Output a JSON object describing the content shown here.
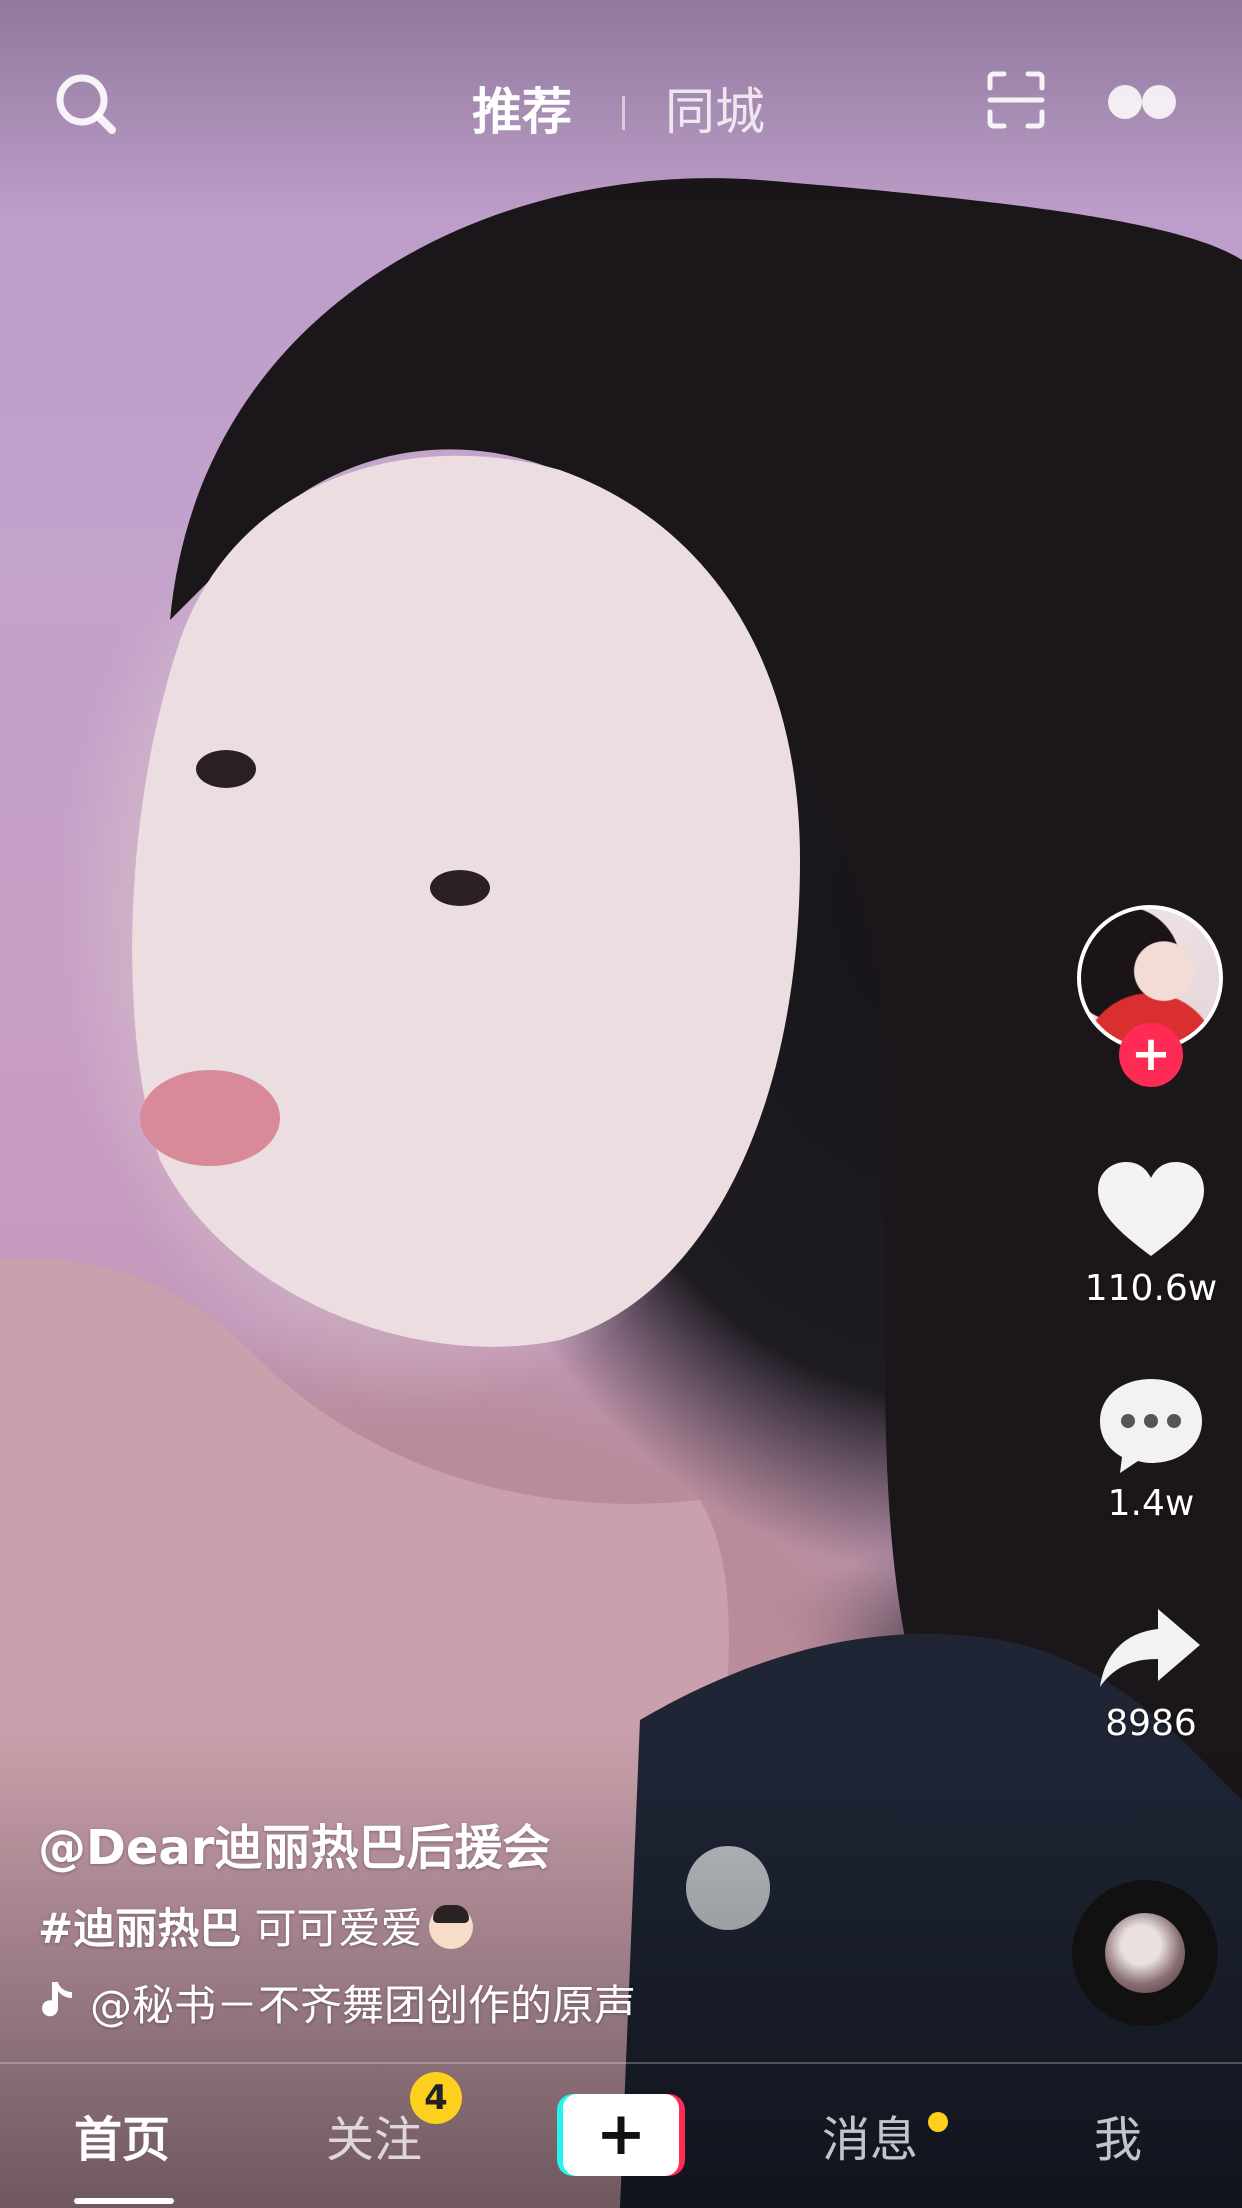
{
  "top_bar": {
    "search_icon": "search-icon",
    "tabs": [
      {
        "label": "推荐",
        "active": true
      },
      {
        "label": "同城",
        "active": false
      }
    ],
    "scan_icon": "scan-icon",
    "live_icon": "live-dots-icon"
  },
  "right_rail": {
    "avatar": "creator-avatar",
    "follow_icon": "+",
    "like_count": "110.6w",
    "comment_count": "1.4w",
    "share_count": "8986",
    "music_disc": "music-disc-icon"
  },
  "caption": {
    "username": "@Dear迪丽热巴后援会",
    "hashtag": "#迪丽热巴",
    "text": " 可可爱爱",
    "music_text": "@秘书－不齐舞团创作的原声"
  },
  "bottom_nav": {
    "items": [
      {
        "label": "首页",
        "active": true
      },
      {
        "label": "关注",
        "badge": "4"
      },
      {
        "label": "+"
      },
      {
        "label": "消息",
        "dot": true
      },
      {
        "label": "我"
      }
    ]
  },
  "colors": {
    "accent_red": "#fe2c55",
    "accent_cyan": "#25f4ee",
    "badge_yellow": "#fdd020"
  }
}
